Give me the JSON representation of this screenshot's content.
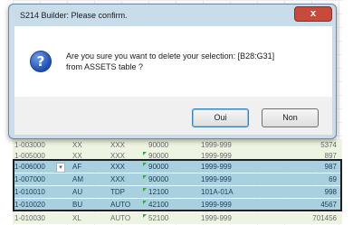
{
  "dialog": {
    "title": "S214 Builder: Please confirm.",
    "close_glyph": "x",
    "icon": "question-icon",
    "message_line1": "Are you sure you want to delete your selection: [B28:G31]",
    "message_line2": "from ASSETS table ?",
    "yes_label": "Oui",
    "no_label": "Non"
  },
  "sheet": {
    "dropdown_glyph": "▾",
    "rows": [
      {
        "ref": "1-003000",
        "code": "XX",
        "xx": "XXX",
        "num": "90000",
        "range": "1999-999",
        "val": "5374",
        "selected": false
      },
      {
        "ref": "1-005000",
        "code": "XX",
        "xx": "XXX",
        "num": "90000",
        "range": "1999-999",
        "val": "897",
        "selected": false
      },
      {
        "ref": "1-006000",
        "code": "AF",
        "xx": "XXX",
        "num": "90000",
        "range": "1999-999",
        "val": "987",
        "selected": true
      },
      {
        "ref": "1-007000",
        "code": "AM",
        "xx": "XXX",
        "num": "90000",
        "range": "1999-999",
        "val": "69",
        "selected": true
      },
      {
        "ref": "1-010010",
        "code": "AU",
        "xx": "TDP",
        "num": "12100",
        "range": "101A-01A",
        "val": "998",
        "selected": true
      },
      {
        "ref": "1-010020",
        "code": "BU",
        "xx": "AUTO",
        "num": "42100",
        "range": "1999-999",
        "val": "4567",
        "selected": true
      },
      {
        "ref": "1-010030",
        "code": "XL",
        "xx": "AUTO",
        "num": "52100",
        "range": "1999-999",
        "val": "701456",
        "selected": false
      }
    ]
  },
  "colors": {
    "selected_row": "#a9d0df",
    "plain_row": "#eef4e2",
    "dialog_frame": "#c9dcea",
    "close_button": "#c74a3b"
  }
}
